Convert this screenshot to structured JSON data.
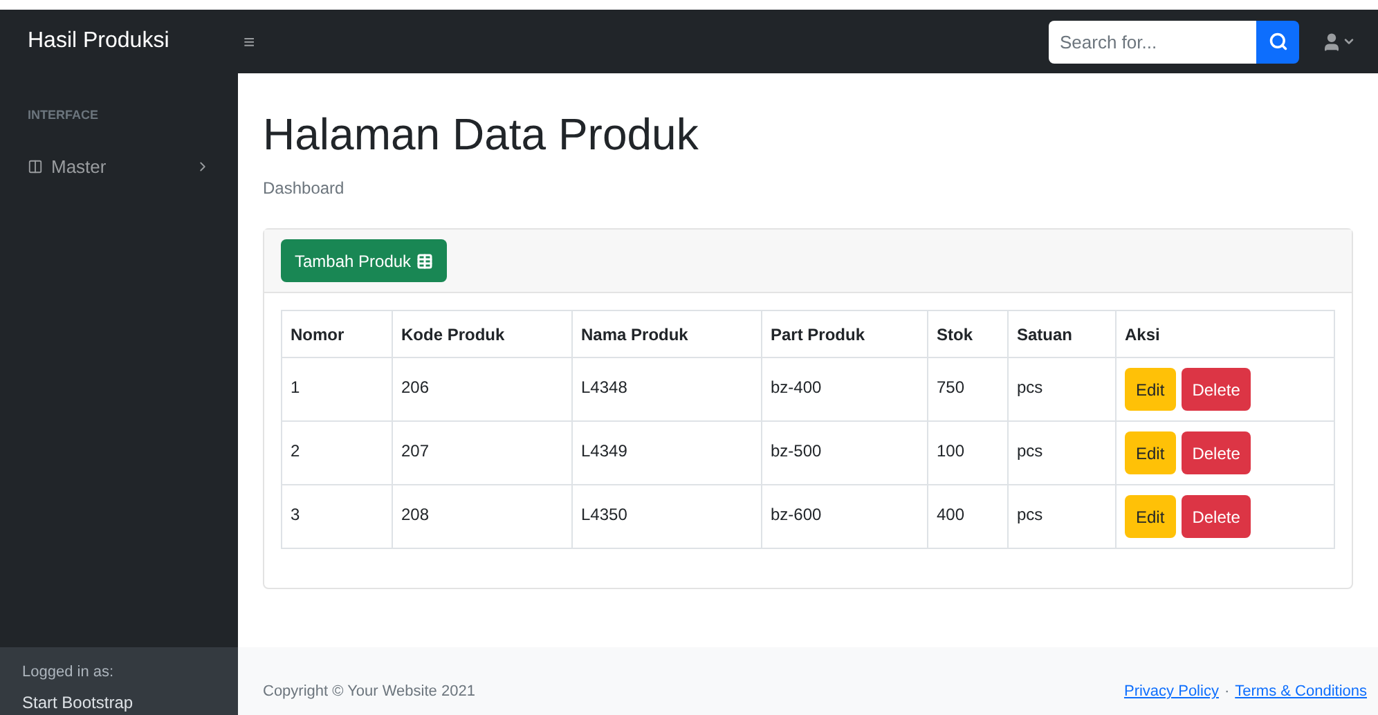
{
  "brand": "Hasil Produksi",
  "menu_toggle": "≡",
  "search": {
    "placeholder": "Search for..."
  },
  "sidebar": {
    "heading": "INTERFACE",
    "items": [
      {
        "label": "Master",
        "expanded": false
      }
    ],
    "footer_label": "Logged in as:",
    "footer_user": "Start Bootstrap"
  },
  "page": {
    "title": "Halaman Data Produk",
    "breadcrumb": "Dashboard"
  },
  "add_button": "Tambah Produk",
  "table": {
    "columns": [
      "Nomor",
      "Kode Produk",
      "Nama Produk",
      "Part Produk",
      "Stok",
      "Satuan",
      "Aksi"
    ],
    "rows": [
      {
        "cells": [
          "1",
          "206",
          "L4348",
          "bz-400",
          "750",
          "pcs"
        ],
        "actions": [
          "Edit",
          "Delete"
        ]
      },
      {
        "cells": [
          "2",
          "207",
          "L4349",
          "bz-500",
          "100",
          "pcs"
        ],
        "actions": [
          "Edit",
          "Delete"
        ]
      },
      {
        "cells": [
          "3",
          "208",
          "L4350",
          "bz-600",
          "400",
          "pcs"
        ],
        "actions": [
          "Edit",
          "Delete"
        ]
      }
    ]
  },
  "footer": {
    "copyright": "Copyright © Your Website 2021",
    "links": [
      "Privacy Policy",
      "Terms & Conditions"
    ],
    "separator": "·"
  }
}
